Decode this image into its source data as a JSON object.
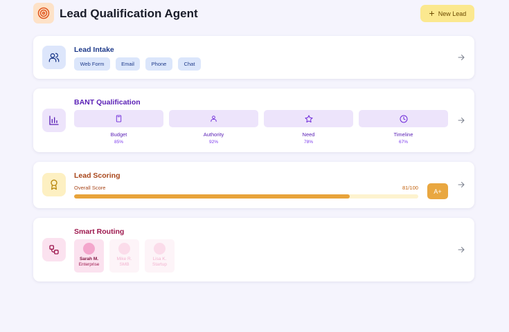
{
  "app": {
    "title": "Lead Qualification Agent",
    "logo_icon": "target-icon",
    "new_button_label": "New Lead",
    "new_button_icon": "plus-icon"
  },
  "colors": {
    "background": "#f5f4fd",
    "intake_accent": "#1e3a8a",
    "bant_accent": "#5b21b6",
    "scoring_accent": "#e8a33a",
    "routing_accent": "#9d174d",
    "new_button": "#fbe88f"
  },
  "intake": {
    "title": "Lead Intake",
    "icon": "users-icon",
    "channels": [
      "Web Form",
      "Email",
      "Phone",
      "Chat"
    ]
  },
  "bant": {
    "title": "BANT Qualification",
    "icon": "bar-chart-icon",
    "criteria": [
      {
        "label": "Budget",
        "percent": "85%",
        "icon": "calculator-icon"
      },
      {
        "label": "Authority",
        "percent": "92%",
        "icon": "user-icon"
      },
      {
        "label": "Need",
        "percent": "78%",
        "icon": "star-icon"
      },
      {
        "label": "Timeline",
        "percent": "67%",
        "icon": "clock-icon"
      }
    ]
  },
  "scoring": {
    "title": "Lead Scoring",
    "icon": "award-icon",
    "score_label": "Overall Score",
    "score_text": "81/100",
    "score_fraction": 0.8,
    "grade": "A+"
  },
  "routing": {
    "title": "Smart Routing",
    "icon": "route-icon",
    "agents": [
      {
        "name": "Sarah M.",
        "segment": "Enterprise",
        "active": true
      },
      {
        "name": "Mike R.",
        "segment": "SMB",
        "active": false
      },
      {
        "name": "Lisa K.",
        "segment": "Startup",
        "active": false
      }
    ]
  }
}
